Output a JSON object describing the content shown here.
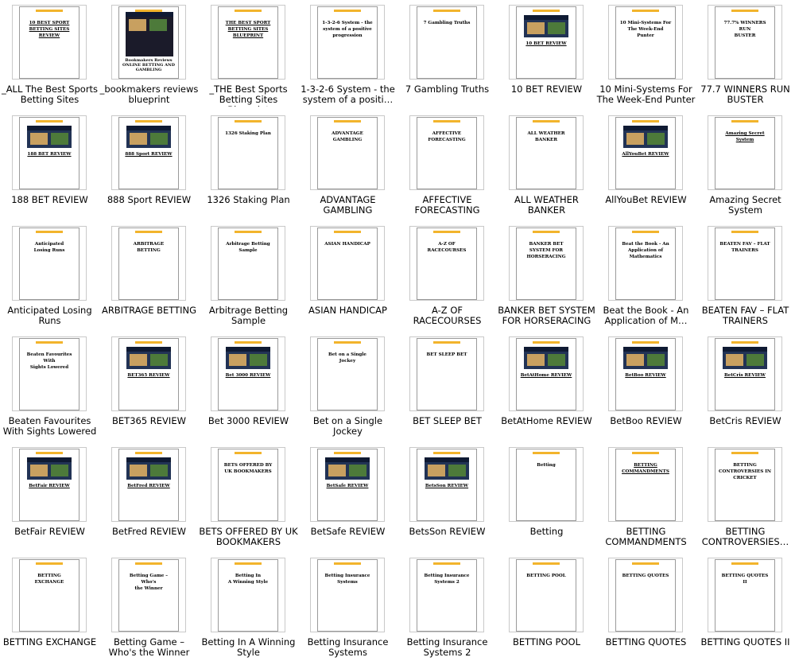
{
  "colors": {
    "label_text": "#000000",
    "page_border": "#9a9a9a",
    "logo_bar": "#f2b42c",
    "frame_border": "#c9c9c9"
  },
  "items": [
    {
      "label": "_ALL The Best Sports Betting Sites",
      "page_title": "10 BEST SPORT\nBETTING SITES\nREVIEW",
      "underline": true,
      "shot": false
    },
    {
      "label": "_bookmakers reviews blueprint",
      "page_title": "Bookmakers Reviews\nONLINE BETTING AND\nGAMBLING",
      "underline": false,
      "shot": true,
      "collage": true
    },
    {
      "label": "_THE Best Sports Betting Sites Blueprint",
      "page_title": "THE BEST SPORT\nBETTING SITES\nBLUEPRINT",
      "underline": true,
      "shot": false
    },
    {
      "label": "1-3-2-6 System - the system of a positi…",
      "page_title": "1-3-2-6 System - the\nsystem of a positive\nprogression",
      "underline": false,
      "shot": false
    },
    {
      "label": "7 Gambling Truths",
      "page_title": "7 Gambling Truths",
      "underline": false,
      "shot": false
    },
    {
      "label": "10 BET REVIEW",
      "page_title": "10 BET REVIEW",
      "underline": true,
      "shot": true
    },
    {
      "label": "10 Mini-Systems For The Week-End Punter",
      "page_title": "10 Mini-Systems For\nThe Week-End Punter",
      "underline": false,
      "shot": false
    },
    {
      "label": "77.7 WINNERS RUN BUSTER",
      "page_title": "77.7% WINNERS RUN\nBUSTER",
      "underline": false,
      "shot": false
    },
    {
      "label": "188 BET REVIEW",
      "page_title": "188 BET REVIEW",
      "underline": true,
      "shot": true
    },
    {
      "label": "888 Sport REVIEW",
      "page_title": "888 Sport REVIEW",
      "underline": true,
      "shot": true
    },
    {
      "label": "1326 Staking Plan",
      "page_title": "1326 Staking Plan",
      "underline": false,
      "shot": false
    },
    {
      "label": "ADVANTAGE GAMBLING",
      "page_title": "ADVANTAGE\nGAMBLING",
      "underline": false,
      "shot": false
    },
    {
      "label": "AFFECTIVE FORECASTING",
      "page_title": "AFFECTIVE\nFORECASTING",
      "underline": false,
      "shot": false
    },
    {
      "label": "ALL WEATHER BANKER",
      "page_title": "ALL WEATHER\nBANKER",
      "underline": false,
      "shot": false
    },
    {
      "label": "AllYouBet REVIEW",
      "page_title": "AllYouBet REVIEW",
      "underline": true,
      "shot": true
    },
    {
      "label": "Amazing Secret System",
      "page_title": "Amazing Secret System",
      "underline": true,
      "shot": false
    },
    {
      "label": "Anticipated Losing Runs",
      "page_title": "Anticipated\nLosing Runs",
      "underline": false,
      "shot": false
    },
    {
      "label": "ARBITRAGE BETTING",
      "page_title": "ARBITRAGE\nBETTING",
      "underline": false,
      "shot": false
    },
    {
      "label": "Arbitrage Betting Sample",
      "page_title": "Arbitrage Betting\nSample",
      "underline": false,
      "shot": false
    },
    {
      "label": "ASIAN HANDICAP",
      "page_title": "ASIAN HANDICAP",
      "underline": false,
      "shot": false
    },
    {
      "label": "A-Z OF RACECOURSES",
      "page_title": "A-Z OF\nRACECOURSES",
      "underline": false,
      "shot": false
    },
    {
      "label": "BANKER BET SYSTEM FOR HORSERACING",
      "page_title": "BANKER BET\nSYSTEM FOR\nHORSERACING",
      "underline": false,
      "shot": false
    },
    {
      "label": "Beat the Book - An Application of M…",
      "page_title": "Beat the Book - An\nApplication of\nMathematics",
      "underline": false,
      "shot": false
    },
    {
      "label": "BEATEN FAV – FLAT TRAINERS",
      "page_title": "BEATEN FAV – FLAT\nTRAINERS",
      "underline": false,
      "shot": false
    },
    {
      "label": "Beaten Favourites With Sights Lowered",
      "page_title": "Beaten Favourites With\nSights Lowered",
      "underline": false,
      "shot": false
    },
    {
      "label": "BET365 REVIEW",
      "page_title": "BET365 REVIEW",
      "underline": true,
      "shot": true
    },
    {
      "label": "Bet 3000 REVIEW",
      "page_title": "Bet 3000 REVIEW",
      "underline": true,
      "shot": true
    },
    {
      "label": "Bet on a Single Jockey",
      "page_title": "Bet on a Single Jockey",
      "underline": false,
      "shot": false
    },
    {
      "label": "BET SLEEP BET",
      "page_title": "BET SLEEP BET",
      "underline": false,
      "shot": false
    },
    {
      "label": "BetAtHome REVIEW",
      "page_title": "BetAtHome REVIEW",
      "underline": true,
      "shot": true
    },
    {
      "label": "BetBoo REVIEW",
      "page_title": "BetBoo REVIEW",
      "underline": true,
      "shot": true
    },
    {
      "label": "BetCris REVIEW",
      "page_title": "BetCris REVIEW",
      "underline": true,
      "shot": true
    },
    {
      "label": "BetFair REVIEW",
      "page_title": "BetFair REVIEW",
      "underline": true,
      "shot": true
    },
    {
      "label": "BetFred REVIEW",
      "page_title": "BetFred REVIEW",
      "underline": true,
      "shot": true
    },
    {
      "label": "BETS OFFERED BY UK BOOKMAKERS",
      "page_title": "BETS OFFERED BY\nUK BOOKMAKERS",
      "underline": false,
      "shot": false
    },
    {
      "label": "BetSafe REVIEW",
      "page_title": "BetSafe REVIEW",
      "underline": true,
      "shot": true
    },
    {
      "label": "BetsSon REVIEW",
      "page_title": "BetsSon REVIEW",
      "underline": true,
      "shot": true
    },
    {
      "label": "Betting",
      "page_title": "Betting",
      "underline": false,
      "shot": false
    },
    {
      "label": "BETTING COMMANDMENTS",
      "page_title": "BETTING\nCOMMANDMENTS",
      "underline": true,
      "shot": false
    },
    {
      "label": "BETTING CONTROVERSIES…",
      "page_title": "BETTING\nCONTROVERSIES IN\nCRICKET",
      "underline": false,
      "shot": false
    },
    {
      "label": "BETTING EXCHANGE",
      "page_title": "BETTING\nEXCHANGE",
      "underline": false,
      "shot": false
    },
    {
      "label": "Betting Game – Who's the Winner",
      "page_title": "Betting Game – Who's\nthe Winner",
      "underline": false,
      "shot": false
    },
    {
      "label": "Betting In A Winning Style",
      "page_title": "Betting In\nA Winning Style",
      "underline": false,
      "shot": false
    },
    {
      "label": "Betting Insurance Systems",
      "page_title": "Betting Insurance\nSystems",
      "underline": false,
      "shot": false
    },
    {
      "label": "Betting Insurance Systems 2",
      "page_title": "Betting Insurance\nSystems 2",
      "underline": false,
      "shot": false
    },
    {
      "label": "BETTING POOL",
      "page_title": "BETTING POOL",
      "underline": false,
      "shot": false
    },
    {
      "label": "BETTING QUOTES",
      "page_title": "BETTING QUOTES",
      "underline": false,
      "shot": false
    },
    {
      "label": "BETTING QUOTES II",
      "page_title": "BETTING QUOTES\nII",
      "underline": false,
      "shot": false
    }
  ]
}
